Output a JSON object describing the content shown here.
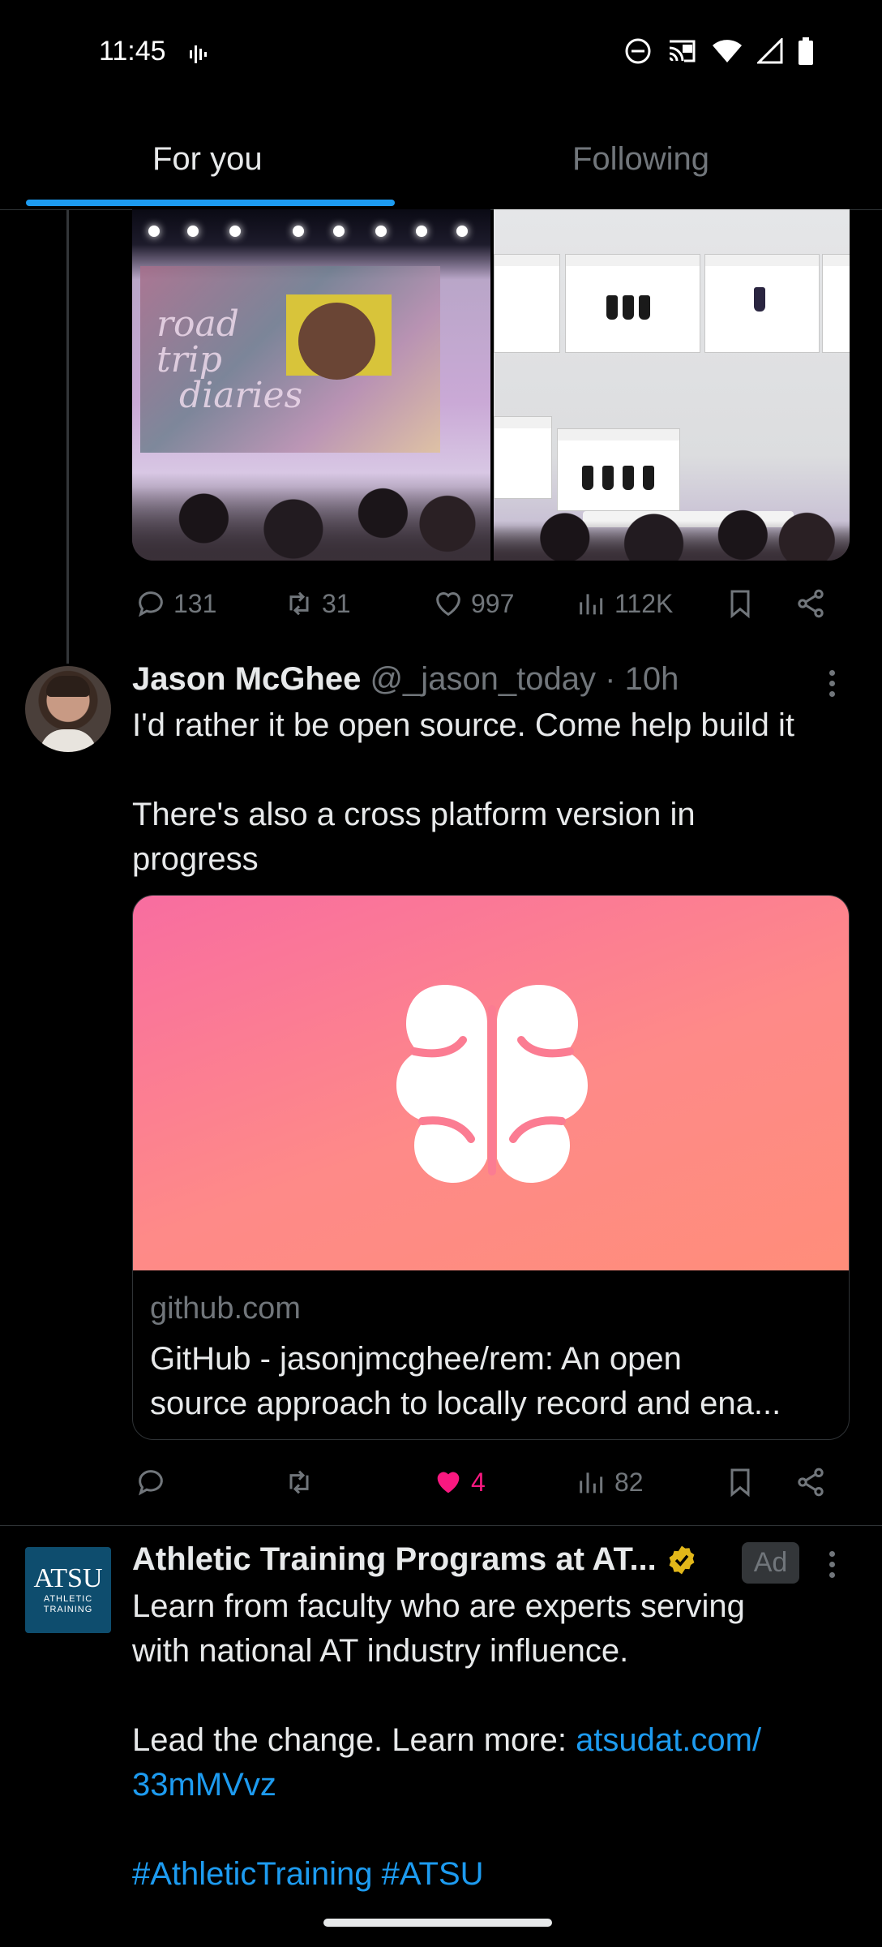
{
  "status_bar": {
    "time": "11:45",
    "icons": [
      "voicemail-icon",
      "dnd-icon",
      "cast-icon",
      "wifi-icon",
      "signal-icon",
      "battery-icon"
    ]
  },
  "tabs": [
    {
      "label": "For you",
      "active": true
    },
    {
      "label": "Following",
      "active": false
    }
  ],
  "tweet1": {
    "actions": {
      "replies": "131",
      "reposts": "31",
      "likes": "997",
      "views": "112K"
    }
  },
  "tweet2": {
    "name": "Jason McGhee",
    "handle": "@_jason_today",
    "time": "· 10h",
    "text_line1": "I'd rather it be open source. Come help build it",
    "text_line2": "There's also a cross platform version in",
    "text_line3": "progress",
    "card": {
      "domain": "github.com",
      "title_line1": "GitHub - jasonjmcghee/rem: An open",
      "title_line2": "source approach to locally record and ena..."
    },
    "actions": {
      "likes": "4",
      "views": "82"
    }
  },
  "ad": {
    "logo_text": "ATSU",
    "logo_sub": "ATHLETIC TRAINING",
    "name": "Athletic Training Programs at AT...",
    "badge": "Ad",
    "text_line1": "Learn from faculty who are experts serving",
    "text_line2": "with national AT industry influence.",
    "text_line3_prefix": "Lead the change. Learn more: ",
    "link_part1": "atsudat.com/",
    "link_part2": "33mMVvz",
    "hashtag1": "#AthleticTraining",
    "hashtag2": "#ATSU"
  },
  "colors": {
    "background": "#000000",
    "accent": "#1d9bf0",
    "muted": "#71767b",
    "like_active": "#f91880",
    "verified": "#e2b719"
  }
}
